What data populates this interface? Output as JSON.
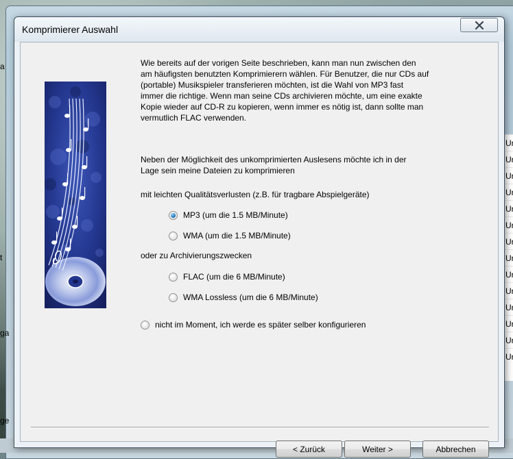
{
  "dialog": {
    "title": "Komprimierer Auswahl",
    "close_symbol": "✕"
  },
  "intro_text": "Wie bereits auf der vorigen Seite beschrieben, kann man nun zwischen den am häufigsten benutzten Komprimierern wählen. Für Benutzer, die nur CDs auf (portable) Musikspieler transferieren möchten, ist die Wahl von MP3 fast immer die richtige. Wenn man seine CDs archivieren möchte, um eine exakte Kopie wieder auf CD-R zu kopieren, wenn immer es nötig ist, dann sollte man vermutlich FLAC verwenden.",
  "intro_lines": [
    "Wie bereits auf der vorigen Seite beschrieben, kann man nun zwischen den",
    "am häufigsten benutzten Komprimierern wählen. Für Benutzer, die nur CDs auf",
    "(portable) Musikspieler transferieren möchten, ist die Wahl von MP3 fast",
    "immer die richtige. Wenn man seine CDs archivieren möchte, um eine exakte",
    "Kopie wieder auf CD-R zu kopieren, wenn immer es nötig ist, dann sollte man",
    "vermutlich FLAC verwenden."
  ],
  "second_lines": [
    "Neben der Möglichkeit des unkomprimierten Auslesens möchte ich in der",
    "Lage sein meine Dateien zu komprimieren"
  ],
  "lossy_heading": "mit leichten Qualitätsverlusten (z.B. für tragbare Abspielgeräte)",
  "archive_heading": "oder zu Archivierungszwecken",
  "options": {
    "mp3": {
      "label": "MP3 (um die 1.5 MB/Minute)",
      "checked": true
    },
    "wma": {
      "label": "WMA (um die 1.5 MB/Minute)",
      "checked": false
    },
    "flac": {
      "label": "FLAC (um die 6 MB/Minute)",
      "checked": false
    },
    "wma_lossless": {
      "label": "WMA Lossless (um die 6 MB/Minute)",
      "checked": false
    },
    "later": {
      "label": "nicht im Moment, ich werde es später selber konfigurieren",
      "checked": false
    }
  },
  "buttons": {
    "back": "< Zurück",
    "next": "Weiter >",
    "cancel": "Abbrechen"
  },
  "background": {
    "list_letters": [
      "Ur",
      "Ur",
      "Ur",
      "Ur",
      "Ur",
      "Ur",
      "Ur",
      "Ur",
      "Ur",
      "Ur",
      "Ur",
      "Ur",
      "Ur",
      "Ur",
      "Ur"
    ],
    "left_letters": [
      "a",
      "t",
      "ga",
      "ge"
    ]
  },
  "colors": {
    "dialog_bg": "#f0f0f0",
    "radio_checked": "#2a7fc1",
    "image_blue": "#23378f"
  }
}
